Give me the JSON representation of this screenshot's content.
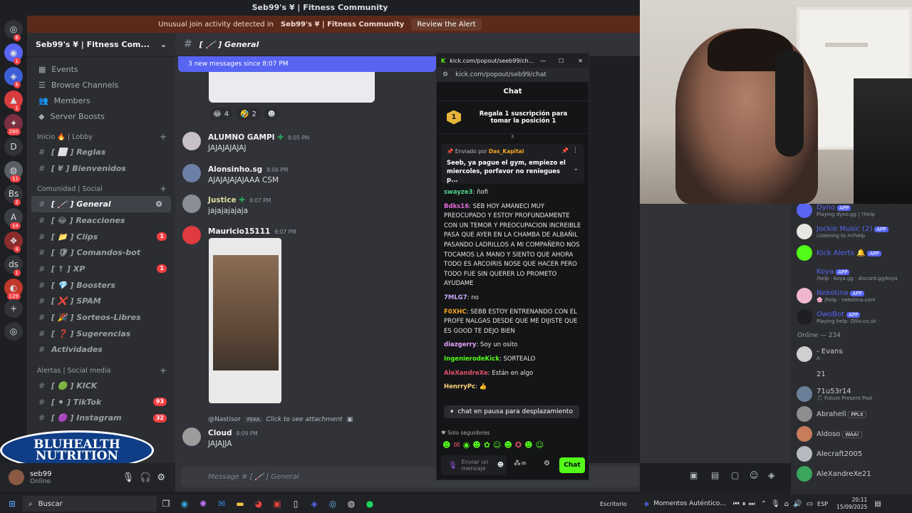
{
  "window": {
    "title": "Seb99's ¥ | Fitness Community"
  },
  "alert": {
    "text_prefix": "Unusual join activity detected in",
    "server": "Seb99's ¥ | Fitness Community",
    "action": "Review the Alert"
  },
  "server_rail": [
    {
      "label": "◎",
      "badge": "6"
    },
    {
      "label": "◉",
      "badge": "1"
    },
    {
      "label": "◈",
      "badge": "6"
    },
    {
      "label": "▲",
      "badge": "1"
    },
    {
      "label": "✦",
      "badge": "260"
    },
    {
      "label": "D",
      "badge": ""
    },
    {
      "label": "◍",
      "badge": "11"
    },
    {
      "label": "Bs",
      "badge": "2"
    },
    {
      "label": "A",
      "badge": "14"
    },
    {
      "label": "❖",
      "badge": "4"
    },
    {
      "label": "ds",
      "badge": "1"
    },
    {
      "label": "◐",
      "badge": "129"
    }
  ],
  "sidebar": {
    "server_name": "Seb99's ¥ | Fitness Com...",
    "nav": [
      "Events",
      "Browse Channels",
      "Members",
      "Server Boosts"
    ],
    "categories": [
      {
        "name": "Inicio 🔥 | Lobby",
        "channels": [
          {
            "name": "[ ⬜ ] Reglas",
            "badge": "",
            "active": false
          },
          {
            "name": "[ ¥ ] Bienvenidos",
            "badge": "",
            "active": false
          }
        ]
      },
      {
        "name": "Comunidad | Social",
        "channels": [
          {
            "name": "[ 🦯 ] General",
            "badge": "",
            "active": true
          },
          {
            "name": "[ 😂 ] Reacciones",
            "badge": "",
            "active": false
          },
          {
            "name": "[ 📁 ] Clips",
            "badge": "1",
            "active": false
          },
          {
            "name": "[ 🛡 ] Comandos-bot",
            "badge": "",
            "active": false
          },
          {
            "name": "[ ↑ ] XP",
            "badge": "1",
            "active": false
          },
          {
            "name": "[ 💎 ] Boosters",
            "badge": "",
            "active": false
          },
          {
            "name": "[ ❌ ] SPAM",
            "badge": "",
            "active": false
          },
          {
            "name": "[ 🎉 ] Sorteos-Libres",
            "badge": "",
            "active": false
          },
          {
            "name": "[ ❓ ] Sugerencias",
            "badge": "",
            "active": false
          },
          {
            "name": "Actividades",
            "badge": "",
            "active": false
          }
        ]
      },
      {
        "name": "Alertas | Social media",
        "channels": [
          {
            "name": "[ 🟢 ] KICK",
            "badge": "",
            "active": false
          },
          {
            "name": "[ ⚫ ] TikTok",
            "badge": "93",
            "active": false
          },
          {
            "name": "[ 🟣 ] Instagram",
            "badge": "32",
            "active": false
          }
        ]
      }
    ],
    "user": {
      "name": "seb99",
      "status": "Online"
    }
  },
  "logo": {
    "line1": "BLUHEALTH",
    "line2": "NUTRITION"
  },
  "channel": {
    "title": "[ 🦯 ] General",
    "new_messages": "3 new messages since 8:07 PM"
  },
  "reactions": [
    {
      "emoji": "😂",
      "count": "4"
    },
    {
      "emoji": "🤣",
      "count": "2"
    },
    {
      "emoji": "☻",
      "count": ""
    }
  ],
  "messages": [
    {
      "author": "ALUMNO GAMPI",
      "time": "8:05 PM",
      "text": "JAJAJAJAJAJ",
      "color": "#f2f3f5"
    },
    {
      "author": "Alonsinho.sg",
      "time": "8:06 PM",
      "text": "AJAJAJAJAJAAA CSM",
      "color": "#f2f3f5"
    },
    {
      "author": "Justice",
      "time": "8:07 PM",
      "text": "jajajajajaja",
      "color": "#f2f3f5"
    },
    {
      "author": "Mauricio15111",
      "time": "8:07 PM",
      "text": "",
      "color": "#f2f3f5"
    },
    {
      "author": "Cloud",
      "time": "8:09 PM",
      "text": "JAJAJJA",
      "color": "#f2f3f5"
    }
  ],
  "reply": {
    "user": "@Nastisor",
    "tag": "FEKA",
    "text": "Click to see attachment"
  },
  "composer": {
    "placeholder": "Message # [ 🦯 ] General"
  },
  "kick": {
    "tab_title": "kick.com/popout/seeb99/ch...",
    "url": "kick.com/popout/seb99/chat",
    "header": "Chat",
    "promo": "Regala 1 suscripción para tomar la posición 1",
    "pinned_by_label": "Enviado por",
    "pinned_by": "Das_Kapital",
    "pinned_text": "Seeb, ya pague el gym, empiezo el miercoles, porfavor no reniegues p...",
    "messages": [
      {
        "user": "swayze3",
        "color": "#4fd18a",
        "text": "ñofi"
      },
      {
        "user": "Bdks16",
        "color": "#e06bd6",
        "text": "SEB HOY AMANECI MUY PREOCUPADO Y ESTOY PROFUNDAMENTE CON UN TEMOR Y PREOCUPACION INCREIBLE PASA QUE AYER EN LA CHAMBA DE ALBAÑIL PASANDO LADRILLOS A MI COMPAÑERO NOS TOCAMOS LA MANO Y SIENTO QUE AHORA TODO ES ARCOIRIS NOSE QUE HACER PERO TODO FUE SIN QUERER LO PROMETO AYUDAME"
      },
      {
        "user": "7MLG7",
        "color": "#c9a8ff",
        "text": "no"
      },
      {
        "user": "F0XHC",
        "color": "#f5a623",
        "text": "SEBB ESTOY ENTRENANDO CON EL PROFE NALGAS DESDE QUE ME DIJISTE QUE ES GOOD TE DEJO BIEN"
      },
      {
        "user": "diazgerry",
        "color": "#e3a3ff",
        "text": "Soy un osito"
      },
      {
        "user": "IngenierodeKick",
        "color": "#53fc18",
        "text": "SORTEALO"
      },
      {
        "user": "AleXandreXe",
        "color": "#e0506b",
        "text": "Están en algo"
      },
      {
        "user": "HenrryPc",
        "color": "#ffd37a",
        "text": "👍"
      }
    ],
    "paused": "chat en pausa para desplazamiento",
    "followers_only": "Solo seguidores",
    "input_placeholder": "Enviar un mensaje",
    "send": "Chat"
  },
  "members": {
    "apps": [
      {
        "name": "Dyno",
        "status": "Playing dyno.gg | ?help",
        "tag": "APP",
        "color": "#5865f2"
      },
      {
        "name": "Jockie Music (2)",
        "status": "Listening to m!help",
        "tag": "APP",
        "color": "#5865f2"
      },
      {
        "name": "Kick Alerts 🔔",
        "status": "",
        "tag": "APP",
        "color": "#53fc18"
      },
      {
        "name": "Koya",
        "status": "/help · koya.gg · discord.gg/koya",
        "tag": "APP",
        "color": "#5865f2"
      },
      {
        "name": "Nekotina",
        "status": "🌸 /help · nekotina.com",
        "tag": "APP",
        "color": "#5865f2"
      },
      {
        "name": "OwoBot",
        "status": "Playing help: Olilo.co.uk ·",
        "tag": "APP",
        "color": "#5865f2"
      }
    ],
    "online_header": "Online — 234",
    "online": [
      {
        "name": "- Evans",
        "status": "A",
        "tag": ""
      },
      {
        "name": "21",
        "status": "",
        "tag": ""
      },
      {
        "name": "71u53r14",
        "status": "🎵 Future Present Past",
        "tag": ""
      },
      {
        "name": "Abrahell",
        "status": "",
        "tag": "PPLX"
      },
      {
        "name": "Aldoso",
        "status": "",
        "tag": "WAA!"
      },
      {
        "name": "Alecraft2005",
        "status": "",
        "tag": ""
      },
      {
        "name": "AleXandreXe21",
        "status": "",
        "tag": ""
      }
    ]
  },
  "taskbar": {
    "search": "Buscar",
    "desktop": "Escritorio",
    "media": "Momentos Auténtico...",
    "lang": "ESP",
    "time": "20:11",
    "date": "15/09/2025"
  }
}
